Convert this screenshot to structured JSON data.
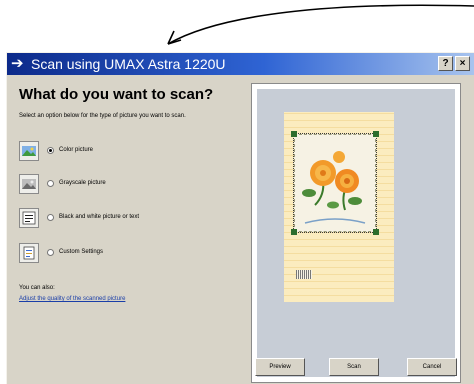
{
  "window": {
    "title": "Scan using UMAX Astra 1220U",
    "help_button": "?",
    "close_button": "×"
  },
  "main": {
    "heading": "What do you want to scan?",
    "instructions": "Select an option below for the type of picture you want to scan.",
    "options": [
      {
        "label": "Color picture",
        "icon": "color-picture-icon",
        "selected": true
      },
      {
        "label": "Grayscale picture",
        "icon": "grayscale-picture-icon",
        "selected": false
      },
      {
        "label": "Black and white picture or text",
        "icon": "black-white-text-icon",
        "selected": false
      },
      {
        "label": "Custom Settings",
        "icon": "custom-settings-icon",
        "selected": false
      }
    ],
    "also_label": "You can also:",
    "adjust_link": "Adjust the quality of the scanned picture"
  },
  "buttons": {
    "preview": "Preview",
    "scan": "Scan",
    "cancel": "Cancel"
  },
  "colors": {
    "title_bar_start": "#0c2a8a",
    "title_bar_end": "#a8c4ee",
    "dialog_bg": "#d8d4c8",
    "link": "#1a3ea8"
  }
}
